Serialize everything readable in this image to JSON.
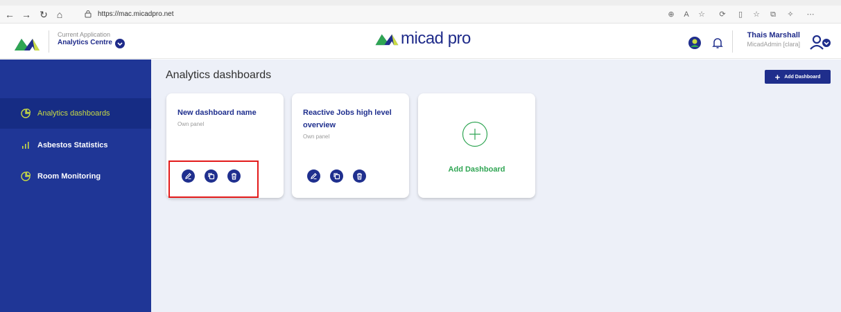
{
  "browser": {
    "url": "https://mac.micadpro.net"
  },
  "header": {
    "current_app_label": "Current Application",
    "current_app_value": "Analytics Centre",
    "brand": "micad pro",
    "user_name": "Thais Marshall",
    "user_role": "MicadAdmin [clara]"
  },
  "sidebar": {
    "items": [
      {
        "label": "Analytics dashboards",
        "icon": "pie-chart-icon",
        "active": true
      },
      {
        "label": "Asbestos Statistics",
        "icon": "bar-chart-icon",
        "active": false
      },
      {
        "label": "Room Monitoring",
        "icon": "pie-chart-icon",
        "active": false
      }
    ]
  },
  "main": {
    "title": "Analytics dashboards",
    "add_button_label": "Add Dashboard",
    "cards": [
      {
        "title": "New dashboard name",
        "subtitle": "Own panel"
      },
      {
        "title": "Reactive Jobs high level overview",
        "subtitle": "Own panel"
      }
    ],
    "add_card_label": "Add Dashboard"
  },
  "colors": {
    "brand_navy": "#1f2e8c",
    "sidebar_bg": "#1f3696",
    "sidebar_active": "#162c84",
    "active_text": "#c9db44",
    "accent_green": "#2fa553",
    "highlight_red": "#e31919"
  }
}
